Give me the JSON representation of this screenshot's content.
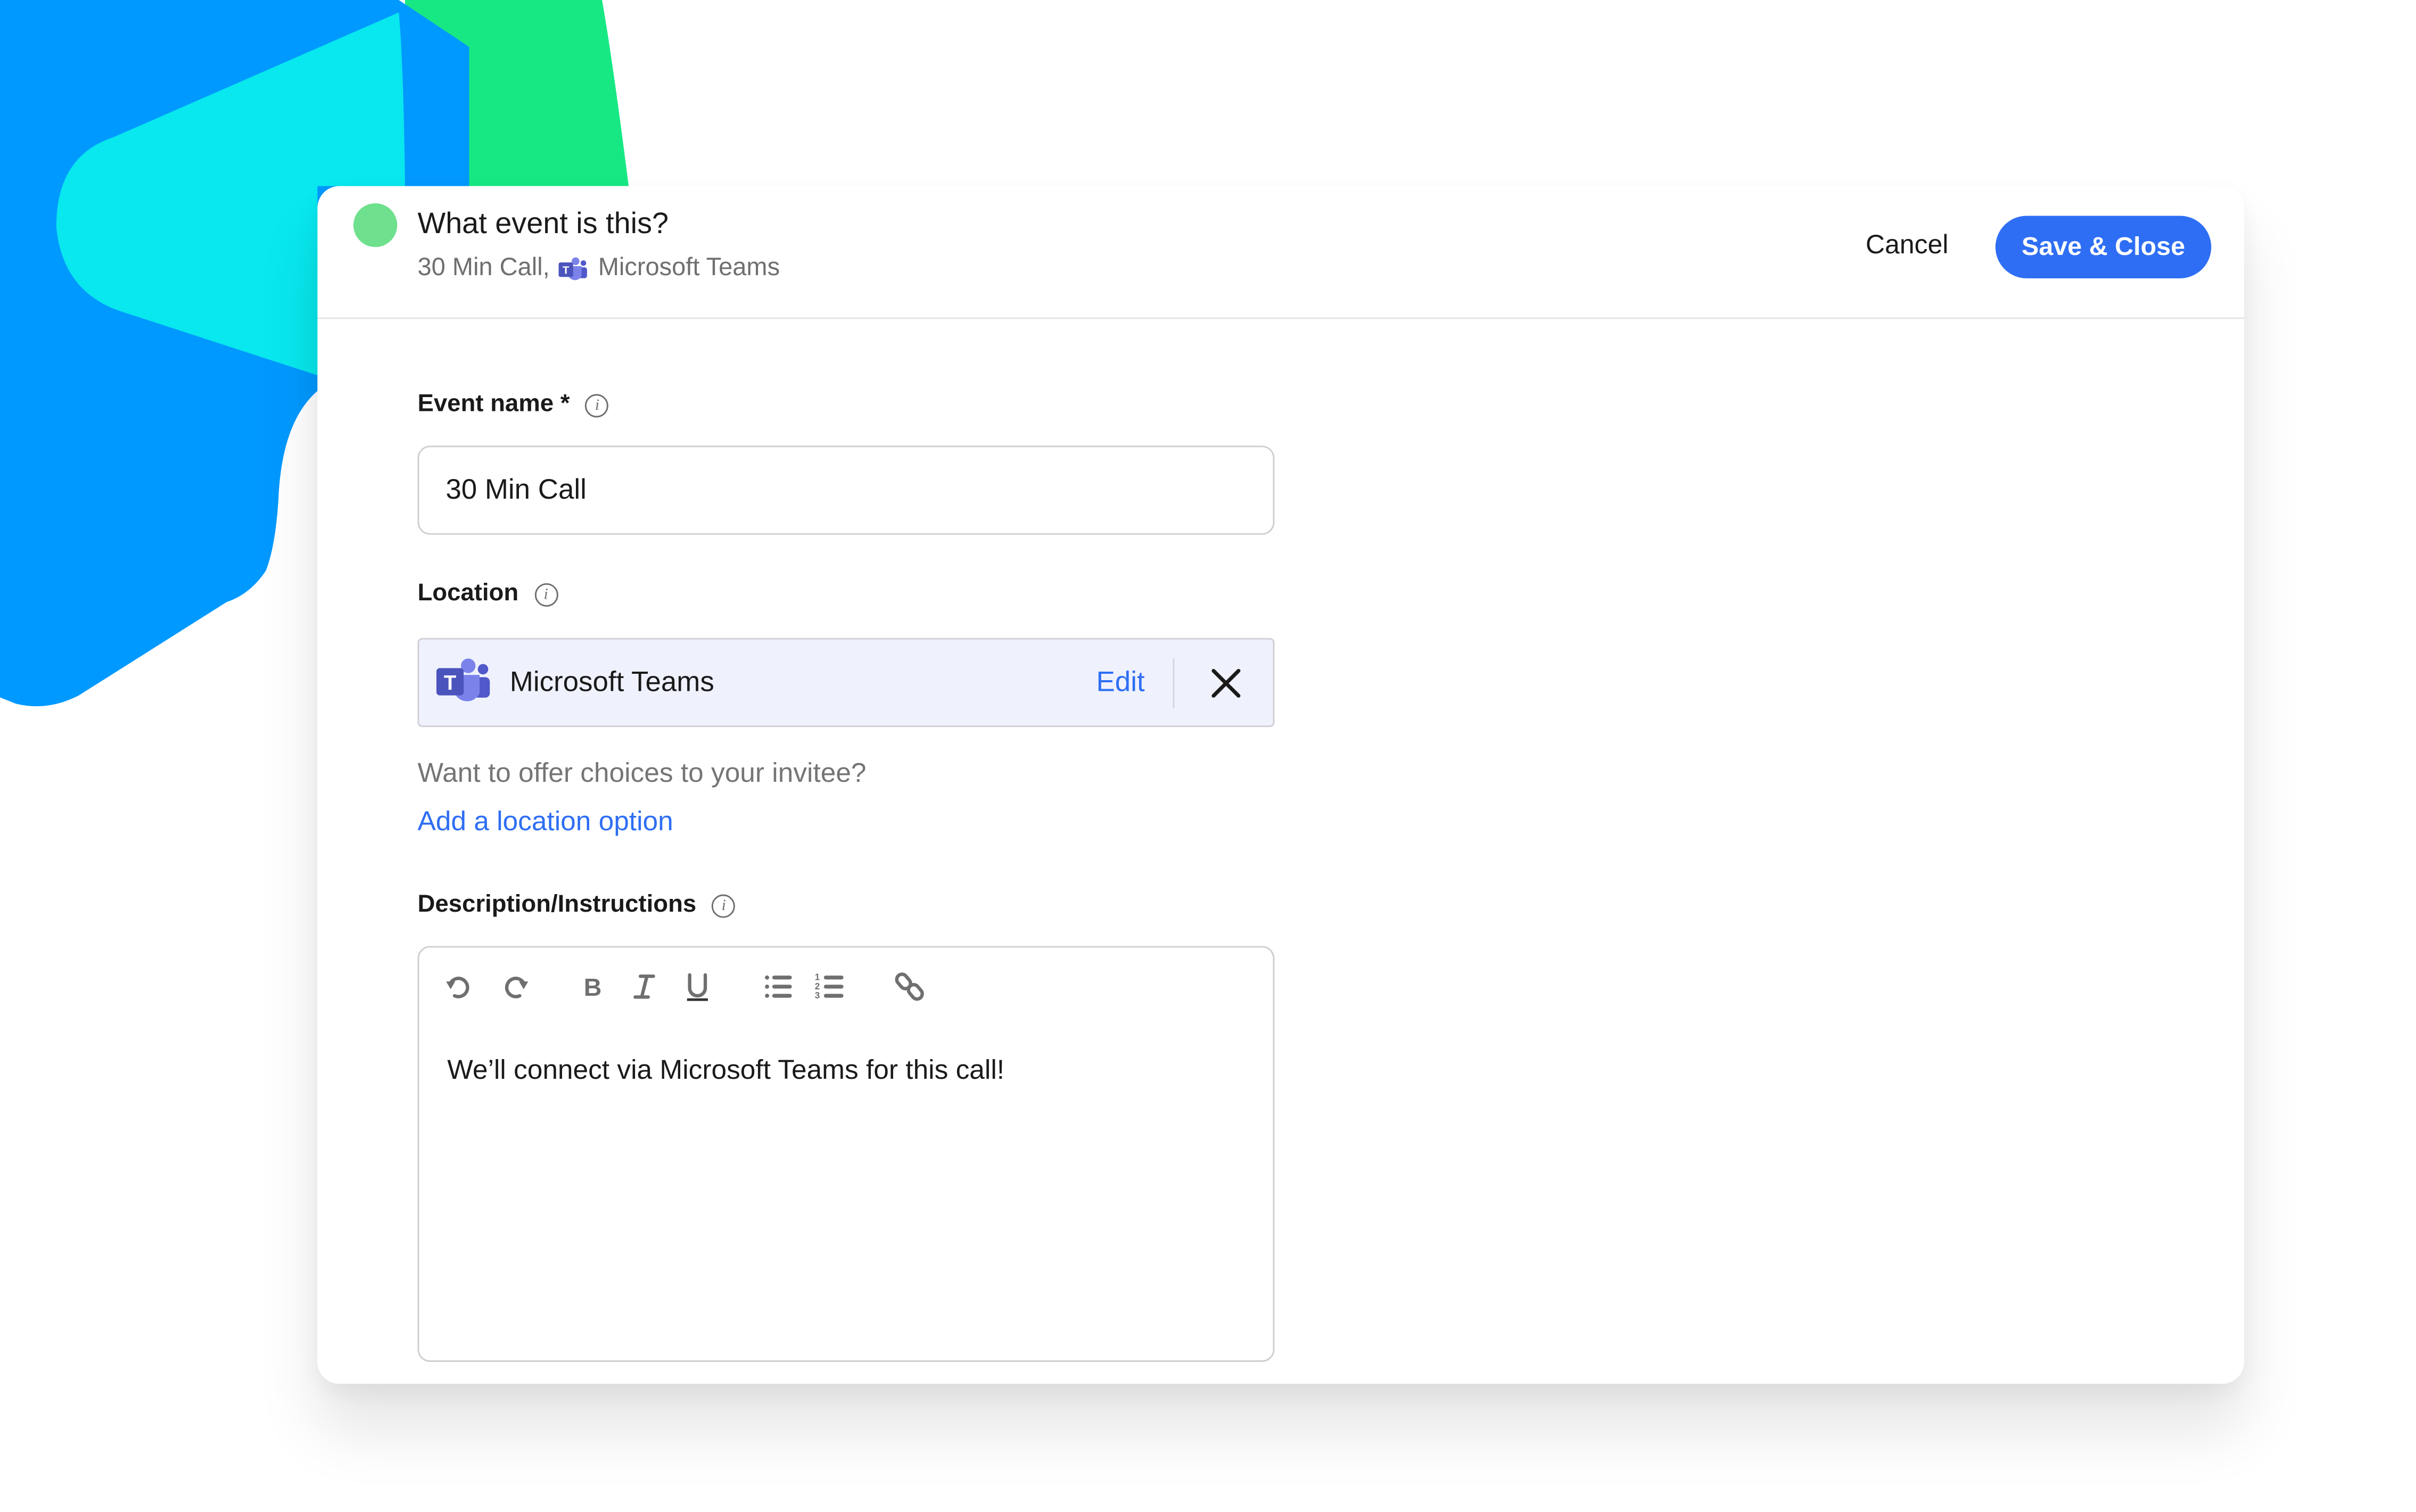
{
  "colors": {
    "accent": "#2e6ef4",
    "event_dot": "#6fe08d",
    "bg_blue": "#0099ff",
    "bg_cyan": "#08e8ee",
    "bg_green": "#18e884",
    "location_bg": "#eff2fd",
    "teams_purple": "#5059c9"
  },
  "header": {
    "title": "What event is this?",
    "subtitle_event": "30 Min Call,",
    "subtitle_location_icon": "microsoft-teams-icon",
    "subtitle_location": "Microsoft Teams",
    "cancel_label": "Cancel",
    "save_label": "Save & Close"
  },
  "form": {
    "event_name": {
      "label": "Event name *",
      "info_icon": "info-icon",
      "value": "30 Min Call"
    },
    "location": {
      "label": "Location",
      "info_icon": "info-icon",
      "selected": {
        "icon": "microsoft-teams-icon",
        "name": "Microsoft Teams",
        "edit_label": "Edit",
        "remove_icon": "close-icon"
      },
      "helper_text": "Want to offer choices to your invitee?",
      "add_option_link": "Add a location option"
    },
    "description": {
      "label": "Description/Instructions",
      "info_icon": "info-icon",
      "toolbar": [
        "undo-icon",
        "redo-icon",
        "bold-icon",
        "italic-icon",
        "underline-icon",
        "bulleted-list-icon",
        "numbered-list-icon",
        "link-icon"
      ],
      "content": "We’ll connect via Microsoft Teams for this call!"
    }
  }
}
